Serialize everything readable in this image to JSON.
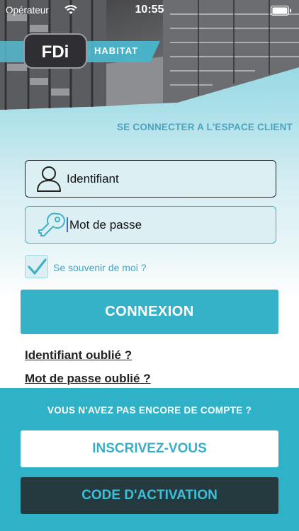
{
  "status_bar": {
    "carrier": "Opérateur",
    "time": "10:55"
  },
  "brand": {
    "logo": "FDi",
    "label": "HABITAT"
  },
  "login": {
    "title": "SE CONNECTER A L'ESPACE CLIENT",
    "username_placeholder": "Identifiant",
    "password_placeholder": "Mot de passe",
    "remember_label": "Se souvenir de moi ?",
    "remember_checked": true,
    "submit_label": "CONNEXION",
    "forgot_username": "Identifiant oublié ?",
    "forgot_password": "Mot de passe oublié ?"
  },
  "signup": {
    "prompt": "VOUS N'AVEZ PAS ENCORE DE COMPTE ?",
    "register_label": "INSCRIVEZ-VOUS",
    "activation_label": "CODE D'ACTIVATION"
  },
  "icons": {
    "username": "user-icon",
    "password": "key-icon",
    "checkbox": "checkmark-icon"
  },
  "colors": {
    "accent": "#35b2c8",
    "title": "#4aa4c2",
    "dark_button": "#243a3f"
  }
}
